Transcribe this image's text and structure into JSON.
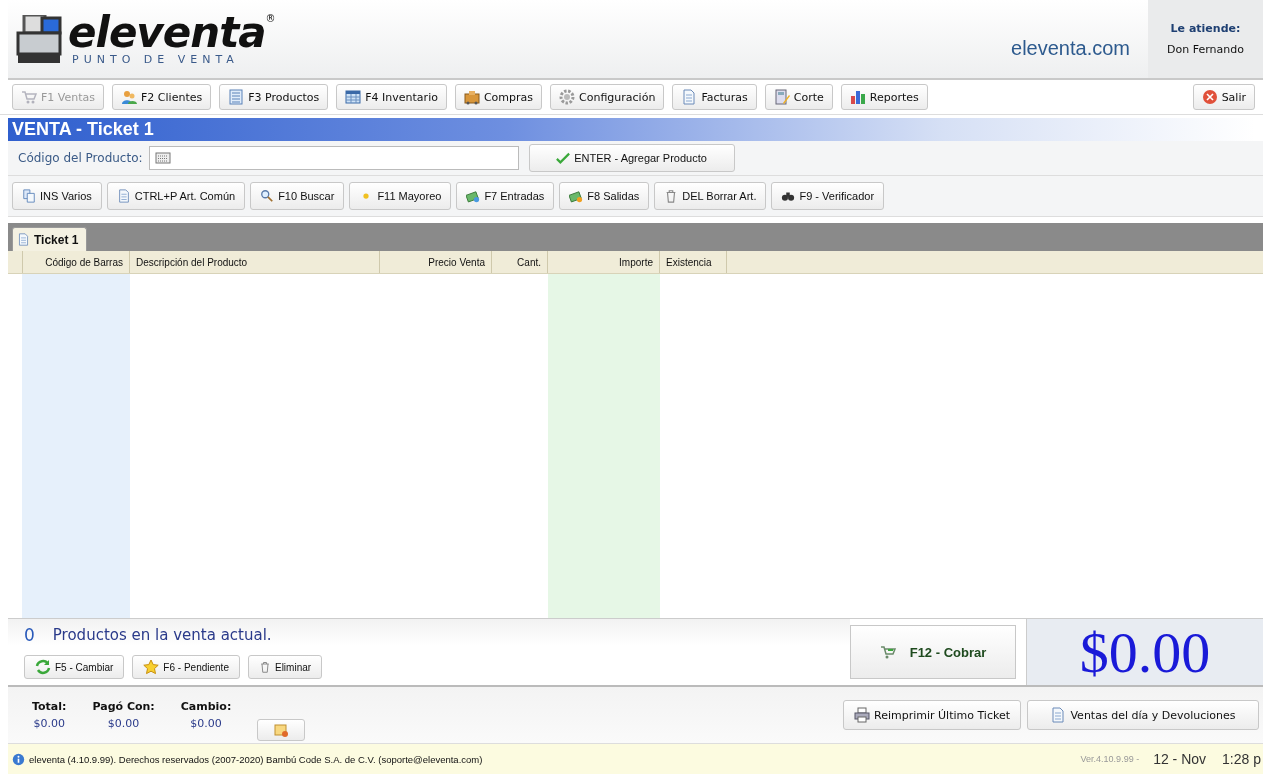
{
  "header": {
    "logo_name": "eleventa",
    "logo_mark": "®",
    "logo_tagline": "PUNTO DE VENTA",
    "website": "eleventa.com",
    "attendant_label": "Le atiende:",
    "attendant_name": "Don Fernando"
  },
  "nav": [
    {
      "label": "F1 Ventas",
      "disabled": true
    },
    {
      "label": "F2 Clientes",
      "disabled": false
    },
    {
      "label": "F3 Productos",
      "disabled": false
    },
    {
      "label": "F4 Inventario",
      "disabled": false
    },
    {
      "label": "Compras",
      "disabled": false
    },
    {
      "label": "Configuración",
      "disabled": false
    },
    {
      "label": "Facturas",
      "disabled": false
    },
    {
      "label": "Corte",
      "disabled": false
    },
    {
      "label": "Reportes",
      "disabled": false
    }
  ],
  "exit_button": "Salir",
  "title": "VENTA - Ticket 1",
  "product_code": {
    "label": "Código del Producto:",
    "add_button": "ENTER - Agregar Producto"
  },
  "actions": [
    "INS Varios",
    "CTRL+P Art. Común",
    "F10 Buscar",
    "F11 Mayoreo",
    "F7 Entradas",
    "F8 Salidas",
    "DEL Borrar Art.",
    "F9 - Verificador"
  ],
  "tabs": [
    {
      "label": "Ticket 1",
      "selected": true
    }
  ],
  "table": {
    "columns": [
      "Código de Barras",
      "Descripción del Producto",
      "Precio Venta",
      "Cant.",
      "Importe",
      "Existencia"
    ]
  },
  "summary": {
    "count": "0",
    "text": "Productos en la venta actual."
  },
  "ticket_buttons": [
    "F5 - Cambiar",
    "F6 - Pendiente",
    "Eliminar"
  ],
  "charge_button": "F12 - Cobrar",
  "total_display": "$0.00",
  "totals": [
    {
      "label": "Total:",
      "value": "$0.00"
    },
    {
      "label": "Pagó Con:",
      "value": "$0.00"
    },
    {
      "label": "Cambio:",
      "value": "$0.00"
    }
  ],
  "report_buttons": [
    "Reimprimir Último Ticket",
    "Ventas del día y Devoluciones"
  ],
  "status_bar": {
    "text": "eleventa (4.10.9.99). Derechos reservados (2007-2020) Bambú Code S.A. de C.V. (soporte@eleventa.com)",
    "version": "Ver.4.10.9.99 -",
    "date": "12 - Nov",
    "time": "1:28 p"
  }
}
